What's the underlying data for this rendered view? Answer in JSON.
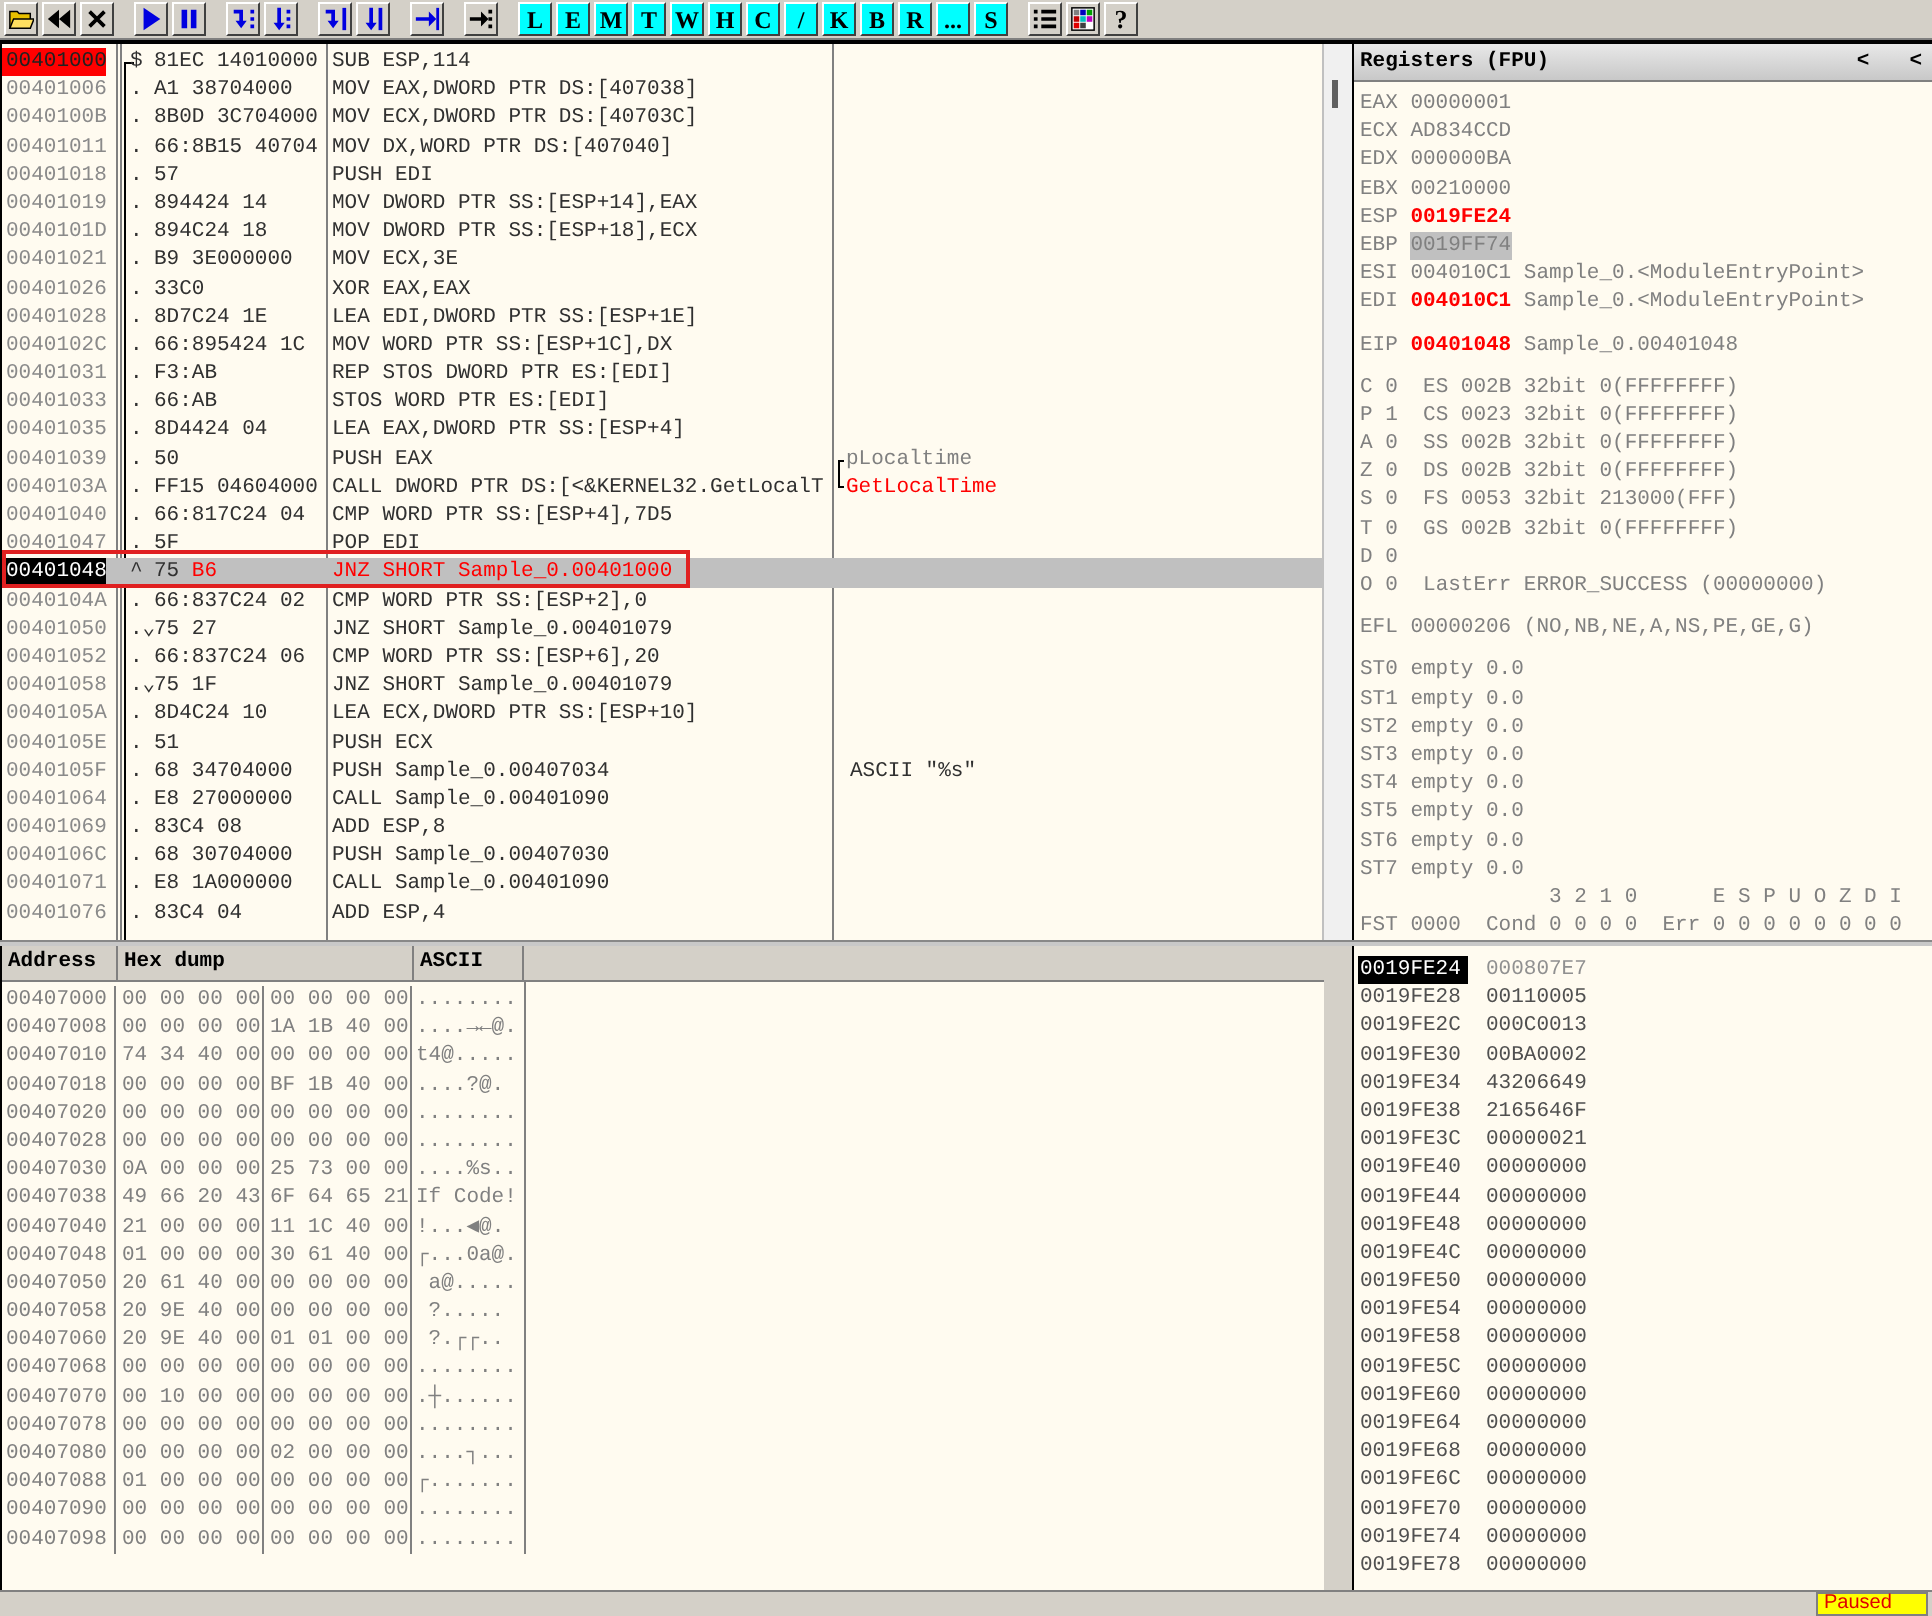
{
  "toolbar": {
    "groups": [
      {
        "buttons": [
          {
            "kind": "open"
          },
          {
            "kind": "restart"
          },
          {
            "kind": "close"
          }
        ]
      },
      {
        "buttons": [
          {
            "kind": "run"
          },
          {
            "kind": "pause"
          }
        ]
      },
      {
        "buttons": [
          {
            "kind": "step-into"
          },
          {
            "kind": "step-over"
          }
        ]
      },
      {
        "buttons": [
          {
            "kind": "trace-into"
          },
          {
            "kind": "trace-over"
          }
        ]
      },
      {
        "buttons": [
          {
            "kind": "till-return"
          }
        ]
      },
      {
        "buttons": [
          {
            "kind": "goto"
          }
        ]
      },
      {
        "buttons": [
          {
            "kind": "letter",
            "label": "L"
          },
          {
            "kind": "letter",
            "label": "E"
          },
          {
            "kind": "letter",
            "label": "M"
          },
          {
            "kind": "letter",
            "label": "T"
          },
          {
            "kind": "letter",
            "label": "W"
          },
          {
            "kind": "letter",
            "label": "H"
          },
          {
            "kind": "letter",
            "label": "C"
          },
          {
            "kind": "letter",
            "label": "/"
          },
          {
            "kind": "letter",
            "label": "K"
          },
          {
            "kind": "letter",
            "label": "B"
          },
          {
            "kind": "letter",
            "label": "R"
          },
          {
            "kind": "letter",
            "label": "..."
          },
          {
            "kind": "letter",
            "label": "S"
          }
        ]
      },
      {
        "buttons": [
          {
            "kind": "list"
          },
          {
            "kind": "colors"
          },
          {
            "kind": "help",
            "label": "?"
          }
        ]
      }
    ]
  },
  "disassembly": {
    "rows": [
      {
        "address": "00401000",
        "mark": "$",
        "hex": "81EC 14010000",
        "instruction": "SUB ESP,114",
        "breakpoint": true,
        "selected": false,
        "taken": false,
        "framed": false
      },
      {
        "address": "00401006",
        "mark": ".",
        "hex": "A1 38704000",
        "instruction": "MOV EAX,DWORD PTR DS:[407038]",
        "breakpoint": false,
        "selected": false,
        "taken": false,
        "framed": false
      },
      {
        "address": "0040100B",
        "mark": ".",
        "hex": "8B0D 3C704000",
        "instruction": "MOV ECX,DWORD PTR DS:[40703C]",
        "breakpoint": false,
        "selected": false,
        "taken": false,
        "framed": false
      },
      {
        "address": "00401011",
        "mark": ".",
        "hex": "66:8B15 40704",
        "instruction": "MOV DX,WORD PTR DS:[407040]",
        "breakpoint": false,
        "selected": false,
        "taken": false,
        "framed": false
      },
      {
        "address": "00401018",
        "mark": ".",
        "hex": "57",
        "instruction": "PUSH EDI",
        "breakpoint": false,
        "selected": false,
        "taken": false,
        "framed": false
      },
      {
        "address": "00401019",
        "mark": ".",
        "hex": "894424 14",
        "instruction": "MOV DWORD PTR SS:[ESP+14],EAX",
        "breakpoint": false,
        "selected": false,
        "taken": false,
        "framed": false
      },
      {
        "address": "0040101D",
        "mark": ".",
        "hex": "894C24 18",
        "instruction": "MOV DWORD PTR SS:[ESP+18],ECX",
        "breakpoint": false,
        "selected": false,
        "taken": false,
        "framed": false
      },
      {
        "address": "00401021",
        "mark": ".",
        "hex": "B9 3E000000",
        "instruction": "MOV ECX,3E",
        "breakpoint": false,
        "selected": false,
        "taken": false,
        "framed": false
      },
      {
        "address": "00401026",
        "mark": ".",
        "hex": "33C0",
        "instruction": "XOR EAX,EAX",
        "breakpoint": false,
        "selected": false,
        "taken": false,
        "framed": false
      },
      {
        "address": "00401028",
        "mark": ".",
        "hex": "8D7C24 1E",
        "instruction": "LEA EDI,DWORD PTR SS:[ESP+1E]",
        "breakpoint": false,
        "selected": false,
        "taken": false,
        "framed": false
      },
      {
        "address": "0040102C",
        "mark": ".",
        "hex": "66:895424 1C",
        "instruction": "MOV WORD PTR SS:[ESP+1C],DX",
        "breakpoint": false,
        "selected": false,
        "taken": false,
        "framed": false
      },
      {
        "address": "00401031",
        "mark": ".",
        "hex": "F3:AB",
        "instruction": "REP STOS DWORD PTR ES:[EDI]",
        "breakpoint": false,
        "selected": false,
        "taken": false,
        "framed": false
      },
      {
        "address": "00401033",
        "mark": ".",
        "hex": "66:AB",
        "instruction": "STOS WORD PTR ES:[EDI]",
        "breakpoint": false,
        "selected": false,
        "taken": false,
        "framed": false
      },
      {
        "address": "00401035",
        "mark": ".",
        "hex": "8D4424 04",
        "instruction": "LEA EAX,DWORD PTR SS:[ESP+4]",
        "breakpoint": false,
        "selected": false,
        "taken": false,
        "framed": false
      },
      {
        "address": "00401039",
        "mark": ".",
        "hex": "50",
        "instruction": "PUSH EAX",
        "comment": {
          "kind": "arg",
          "text": "pLocaltime"
        },
        "breakpoint": false,
        "selected": false,
        "taken": false,
        "framed": false
      },
      {
        "address": "0040103A",
        "mark": ".",
        "hex": "FF15 04604000",
        "instruction": "CALL DWORD PTR DS:[<&KERNEL32.GetLocalT",
        "comment": {
          "kind": "call",
          "text": "GetLocalTime"
        },
        "breakpoint": false,
        "selected": false,
        "taken": false,
        "framed": false
      },
      {
        "address": "00401040",
        "mark": ".",
        "hex": "66:817C24 04",
        "instruction": "CMP WORD PTR SS:[ESP+4],7D5",
        "breakpoint": false,
        "selected": false,
        "taken": false,
        "framed": false
      },
      {
        "address": "00401047",
        "mark": ".",
        "hex": "5F",
        "instruction": "POP EDI",
        "breakpoint": false,
        "selected": false,
        "taken": false,
        "framed": false
      },
      {
        "address": "00401048",
        "mark": "^",
        "hex": "75 B6",
        "instruction": "JNZ SHORT Sample_0.00401000",
        "breakpoint": false,
        "selected": true,
        "taken": true,
        "framed": true
      },
      {
        "address": "0040104A",
        "mark": ".",
        "hex": "66:837C24 02",
        "instruction": "CMP WORD PTR SS:[ESP+2],0",
        "breakpoint": false,
        "selected": false,
        "taken": false,
        "framed": false
      },
      {
        "address": "00401050",
        "mark": ".⌄",
        "hex": "75 27",
        "instruction": "JNZ SHORT Sample_0.00401079",
        "breakpoint": false,
        "selected": false,
        "taken": false,
        "framed": false
      },
      {
        "address": "00401052",
        "mark": ".",
        "hex": "66:837C24 06",
        "instruction": "CMP WORD PTR SS:[ESP+6],20",
        "breakpoint": false,
        "selected": false,
        "taken": false,
        "framed": false
      },
      {
        "address": "00401058",
        "mark": ".⌄",
        "hex": "75 1F",
        "instruction": "JNZ SHORT Sample_0.00401079",
        "breakpoint": false,
        "selected": false,
        "taken": false,
        "framed": false
      },
      {
        "address": "0040105A",
        "mark": ".",
        "hex": "8D4C24 10",
        "instruction": "LEA ECX,DWORD PTR SS:[ESP+10]",
        "breakpoint": false,
        "selected": false,
        "taken": false,
        "framed": false
      },
      {
        "address": "0040105E",
        "mark": ".",
        "hex": "51",
        "instruction": "PUSH ECX",
        "breakpoint": false,
        "selected": false,
        "taken": false,
        "framed": false
      },
      {
        "address": "0040105F",
        "mark": ".",
        "hex": "68 34704000",
        "instruction": "PUSH Sample_0.00407034",
        "comment": {
          "kind": "plain",
          "text": "ASCII \"%s\""
        },
        "breakpoint": false,
        "selected": false,
        "taken": false,
        "framed": false
      },
      {
        "address": "00401064",
        "mark": ".",
        "hex": "E8 27000000",
        "instruction": "CALL Sample_0.00401090",
        "breakpoint": false,
        "selected": false,
        "taken": false,
        "framed": false
      },
      {
        "address": "00401069",
        "mark": ".",
        "hex": "83C4 08",
        "instruction": "ADD ESP,8",
        "breakpoint": false,
        "selected": false,
        "taken": false,
        "framed": false
      },
      {
        "address": "0040106C",
        "mark": ".",
        "hex": "68 30704000",
        "instruction": "PUSH Sample_0.00407030",
        "breakpoint": false,
        "selected": false,
        "taken": false,
        "framed": false
      },
      {
        "address": "00401071",
        "mark": ".",
        "hex": "E8 1A000000",
        "instruction": "CALL Sample_0.00401090",
        "breakpoint": false,
        "selected": false,
        "taken": false,
        "framed": false
      },
      {
        "address": "00401076",
        "mark": ".",
        "hex": "83C4 04",
        "instruction": "ADD ESP,4",
        "breakpoint": false,
        "selected": false,
        "taken": false,
        "framed": false
      }
    ]
  },
  "registers": {
    "title": "Registers (FPU)",
    "arrows": [
      "<",
      "<"
    ],
    "groups": [
      {
        "lines": [
          {
            "kind": "reg",
            "name": "EAX",
            "value": "00000001",
            "changed": false,
            "selected": false
          },
          {
            "kind": "reg",
            "name": "ECX",
            "value": "AD834CCD",
            "changed": false,
            "selected": false
          },
          {
            "kind": "reg",
            "name": "EDX",
            "value": "000000BA",
            "changed": false,
            "selected": false
          },
          {
            "kind": "reg",
            "name": "EBX",
            "value": "00210000",
            "changed": false,
            "selected": false
          },
          {
            "kind": "reg",
            "name": "ESP",
            "value": "0019FE24",
            "changed": true,
            "selected": false
          },
          {
            "kind": "reg",
            "name": "EBP",
            "value": "0019FF74",
            "changed": false,
            "selected": true
          },
          {
            "kind": "reg",
            "name": "ESI",
            "value": "004010C1",
            "comment": "Sample_0.<ModuleEntryPoint>",
            "changed": false,
            "selected": false
          },
          {
            "kind": "reg",
            "name": "EDI",
            "value": "004010C1",
            "comment": "Sample_0.<ModuleEntryPoint>",
            "changed": true,
            "selected": false
          }
        ]
      },
      {
        "lines": [
          {
            "kind": "reg",
            "name": "EIP",
            "value": "00401048",
            "comment": "Sample_0.00401048",
            "changed": true,
            "selected": false
          }
        ]
      },
      {
        "lines": [
          {
            "kind": "flag",
            "name": "C",
            "value": "0",
            "comment": "ES 002B 32bit 0(FFFFFFFF)",
            "changed": false,
            "selected": false
          },
          {
            "kind": "flag",
            "name": "P",
            "value": "1",
            "comment": "CS 0023 32bit 0(FFFFFFFF)",
            "changed": false,
            "selected": false
          },
          {
            "kind": "flag",
            "name": "A",
            "value": "0",
            "comment": "SS 002B 32bit 0(FFFFFFFF)",
            "changed": false,
            "selected": false
          },
          {
            "kind": "flag",
            "name": "Z",
            "value": "0",
            "comment": "DS 002B 32bit 0(FFFFFFFF)",
            "changed": false,
            "selected": false
          },
          {
            "kind": "flag",
            "name": "S",
            "value": "0",
            "comment": "FS 0053 32bit 213000(FFF)",
            "changed": false,
            "selected": false
          },
          {
            "kind": "flag",
            "name": "T",
            "value": "0",
            "comment": "GS 002B 32bit 0(FFFFFFFF)",
            "changed": false,
            "selected": false
          },
          {
            "kind": "flag",
            "name": "D",
            "value": "0",
            "changed": false,
            "selected": false
          },
          {
            "kind": "flag",
            "name": "O",
            "value": "0",
            "comment": "LastErr ERROR_SUCCESS (00000000)",
            "changed": false,
            "selected": false
          }
        ]
      },
      {
        "lines": [
          {
            "kind": "reg",
            "name": "EFL",
            "value": "00000206",
            "comment": "(NO,NB,NE,A,NS,PE,GE,G)",
            "changed": false,
            "selected": false
          }
        ]
      },
      {
        "lines": [
          {
            "kind": "reg",
            "name": "ST0",
            "value": "empty 0.0",
            "changed": false,
            "selected": false
          },
          {
            "kind": "reg",
            "name": "ST1",
            "value": "empty 0.0",
            "changed": false,
            "selected": false
          },
          {
            "kind": "reg",
            "name": "ST2",
            "value": "empty 0.0",
            "changed": false,
            "selected": false
          },
          {
            "kind": "reg",
            "name": "ST3",
            "value": "empty 0.0",
            "changed": false,
            "selected": false
          },
          {
            "kind": "reg",
            "name": "ST4",
            "value": "empty 0.0",
            "changed": false,
            "selected": false
          },
          {
            "kind": "reg",
            "name": "ST5",
            "value": "empty 0.0",
            "changed": false,
            "selected": false
          },
          {
            "kind": "reg",
            "name": "ST6",
            "value": "empty 0.0",
            "changed": false,
            "selected": false
          },
          {
            "kind": "reg",
            "name": "ST7",
            "value": "empty 0.0",
            "changed": false,
            "selected": false
          },
          {
            "kind": "text",
            "text": "               3 2 1 0      E S P U O Z D I",
            "changed": false,
            "selected": false
          },
          {
            "kind": "text",
            "text": "FST 0000  Cond 0 0 0 0  Err 0 0 0 0 0 0 0 0",
            "changed": false,
            "selected": false
          }
        ]
      }
    ]
  },
  "dump": {
    "columns": [
      "Address",
      "Hex dump",
      "ASCII"
    ],
    "rows": [
      {
        "address": "00407000",
        "hex": [
          "00 00 00 00",
          "00 00 00 00"
        ],
        "ascii": "........"
      },
      {
        "address": "00407008",
        "hex": [
          "00 00 00 00",
          "1A 1B 40 00"
        ],
        "ascii": "....→←@."
      },
      {
        "address": "00407010",
        "hex": [
          "74 34 40 00",
          "00 00 00 00"
        ],
        "ascii": "t4@....."
      },
      {
        "address": "00407018",
        "hex": [
          "00 00 00 00",
          "BF 1B 40 00"
        ],
        "ascii": "....?@."
      },
      {
        "address": "00407020",
        "hex": [
          "00 00 00 00",
          "00 00 00 00"
        ],
        "ascii": "........"
      },
      {
        "address": "00407028",
        "hex": [
          "00 00 00 00",
          "00 00 00 00"
        ],
        "ascii": "........"
      },
      {
        "address": "00407030",
        "hex": [
          "0A 00 00 00",
          "25 73 00 00"
        ],
        "ascii": "....%s.."
      },
      {
        "address": "00407038",
        "hex": [
          "49 66 20 43",
          "6F 64 65 21"
        ],
        "ascii": "If Code!"
      },
      {
        "address": "00407040",
        "hex": [
          "21 00 00 00",
          "11 1C 40 00"
        ],
        "ascii": "!...◀@."
      },
      {
        "address": "00407048",
        "hex": [
          "01 00 00 00",
          "30 61 40 00"
        ],
        "ascii": "┌...0a@."
      },
      {
        "address": "00407050",
        "hex": [
          "20 61 40 00",
          "00 00 00 00"
        ],
        "ascii": " a@....."
      },
      {
        "address": "00407058",
        "hex": [
          "20 9E 40 00",
          "00 00 00 00"
        ],
        "ascii": " ?....."
      },
      {
        "address": "00407060",
        "hex": [
          "20 9E 40 00",
          "01 01 00 00"
        ],
        "ascii": " ?.┌┌.."
      },
      {
        "address": "00407068",
        "hex": [
          "00 00 00 00",
          "00 00 00 00"
        ],
        "ascii": "........"
      },
      {
        "address": "00407070",
        "hex": [
          "00 10 00 00",
          "00 00 00 00"
        ],
        "ascii": ".┼......"
      },
      {
        "address": "00407078",
        "hex": [
          "00 00 00 00",
          "00 00 00 00"
        ],
        "ascii": "........"
      },
      {
        "address": "00407080",
        "hex": [
          "00 00 00 00",
          "02 00 00 00"
        ],
        "ascii": "....┐..."
      },
      {
        "address": "00407088",
        "hex": [
          "01 00 00 00",
          "00 00 00 00"
        ],
        "ascii": "┌......."
      },
      {
        "address": "00407090",
        "hex": [
          "00 00 00 00",
          "00 00 00 00"
        ],
        "ascii": "........"
      },
      {
        "address": "00407098",
        "hex": [
          "00 00 00 00",
          "00 00 00 00"
        ],
        "ascii": "........"
      }
    ]
  },
  "stack": {
    "rows": [
      {
        "address": "0019FE24",
        "value": "000807E7",
        "selected": true
      },
      {
        "address": "0019FE28",
        "value": "00110005",
        "selected": false
      },
      {
        "address": "0019FE2C",
        "value": "000C0013",
        "selected": false
      },
      {
        "address": "0019FE30",
        "value": "00BA0002",
        "selected": false
      },
      {
        "address": "0019FE34",
        "value": "43206649",
        "selected": false
      },
      {
        "address": "0019FE38",
        "value": "2165646F",
        "selected": false
      },
      {
        "address": "0019FE3C",
        "value": "00000021",
        "selected": false
      },
      {
        "address": "0019FE40",
        "value": "00000000",
        "selected": false
      },
      {
        "address": "0019FE44",
        "value": "00000000",
        "selected": false
      },
      {
        "address": "0019FE48",
        "value": "00000000",
        "selected": false
      },
      {
        "address": "0019FE4C",
        "value": "00000000",
        "selected": false
      },
      {
        "address": "0019FE50",
        "value": "00000000",
        "selected": false
      },
      {
        "address": "0019FE54",
        "value": "00000000",
        "selected": false
      },
      {
        "address": "0019FE58",
        "value": "00000000",
        "selected": false
      },
      {
        "address": "0019FE5C",
        "value": "00000000",
        "selected": false
      },
      {
        "address": "0019FE60",
        "value": "00000000",
        "selected": false
      },
      {
        "address": "0019FE64",
        "value": "00000000",
        "selected": false
      },
      {
        "address": "0019FE68",
        "value": "00000000",
        "selected": false
      },
      {
        "address": "0019FE6C",
        "value": "00000000",
        "selected": false
      },
      {
        "address": "0019FE70",
        "value": "00000000",
        "selected": false
      },
      {
        "address": "0019FE74",
        "value": "00000000",
        "selected": false
      },
      {
        "address": "0019FE78",
        "value": "00000000",
        "selected": false
      }
    ]
  },
  "status_bar": {
    "state": "Paused"
  }
}
